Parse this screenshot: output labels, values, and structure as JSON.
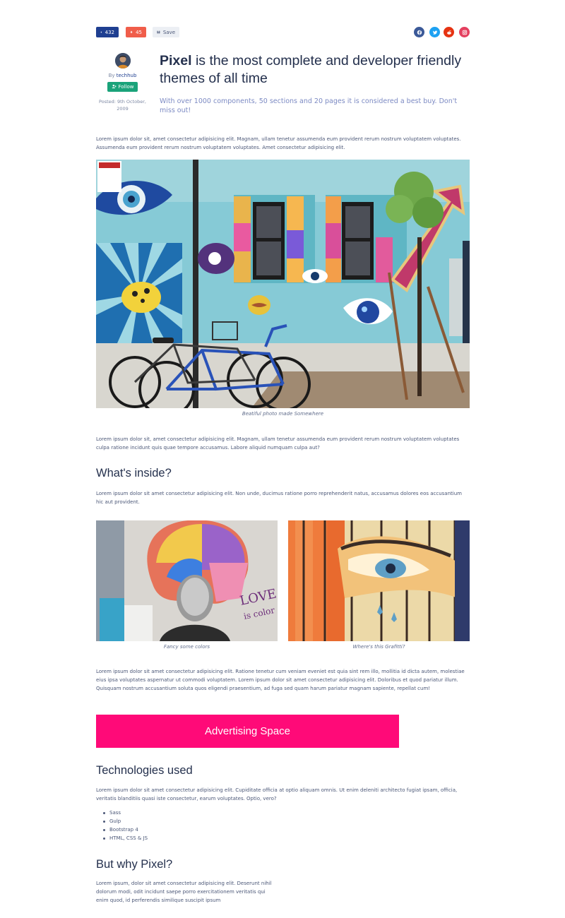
{
  "actions": {
    "upvotes": "432",
    "downvotes": "45",
    "save_label": "Save"
  },
  "social": [
    {
      "name": "facebook",
      "color": "#3b5998",
      "icon": "facebook-icon"
    },
    {
      "name": "twitter",
      "color": "#1da1f2",
      "icon": "twitter-icon"
    },
    {
      "name": "reddit",
      "color": "#e63312",
      "icon": "reddit-icon"
    },
    {
      "name": "instagram",
      "color": "#e4405f",
      "icon": "instagram-icon"
    }
  ],
  "author": {
    "by_prefix": "By",
    "name": "techhub",
    "follow_label": "Follow",
    "posted": "Posted: 9th October, 2009"
  },
  "article": {
    "title_brand": "Pixel",
    "title_rest": " is the most complete and developer friendly themes of all time",
    "subtitle": "With over 1000 components, 50 sections and 20 pages it is considered a best buy. Don't miss out!",
    "intro": "Lorem ipsum dolor sit, amet consectetur adipisicing elit. Magnam, ullam tenetur assumenda eum provident rerum nostrum voluptatem voluptates. Assumenda eum provident rerum nostrum voluptatem voluptates. Amet consectetur adipisicing elit.",
    "main_caption": "Beatiful photo made Somewhere",
    "para2": "Lorem ipsum dolor sit, amet consectetur adipisicing elit. Magnam, ullam tenetur assumenda eum provident rerum nostrum voluptatem voluptates culpa ratione incidunt quis quae tempore accusamus. Labore aliquid numquam culpa aut?",
    "section1_heading": "What's inside?",
    "section1_text": "Lorem ipsum dolor sit amet consectetur adipisicing elit. Non unde, ducimus ratione porro reprehenderit natus, accusamus dolores eos accusantium hic aut provident.",
    "caption_left": "Fancy some colors",
    "caption_right": "Where's this Grafitti?",
    "para3": "Lorem ipsum dolor sit amet consectetur adipisicing elit. Ratione tenetur cum veniam eveniet est quia sint rem illo, mollitia id dicta autem, molestiae eius ipsa voluptates aspernatur ut commodi voluptatem. Lorem ipsum dolor sit amet consectetur adipisicing elit. Doloribus et quod pariatur illum. Quisquam nostrum accusantium soluta quos eligendi praesentium, ad fuga sed quam harum pariatur magnam sapiente, repellat cum!",
    "ad_label": "Advertising Space",
    "section2_heading": "Technologies used",
    "section2_text": "Lorem ipsum dolor sit amet consectetur adipisicing elit. Cupiditate officia at optio aliquam omnis. Ut enim deleniti architecto fugiat ipsam, officia, veritatis blanditiis quasi iste consectetur, earum voluptates. Optio, vero?",
    "tech_list": [
      "Sass",
      "Gulp",
      "Bootstrap 4",
      "HTML, CSS & JS"
    ],
    "section3_heading": "But why Pixel?",
    "section3_text": "Lorem ipsum, dolor sit amet consectetur adipisicing elit. Deserunt nihil dolorum modi, odit incidunt saepe porro exercitationem veritatis qui enim quod, id perferendis similique suscipit ipsum"
  },
  "colors": {
    "primary": "#1f3f91",
    "danger": "#f05d4a",
    "success": "#1aa37a",
    "ad": "#ff0a78"
  }
}
